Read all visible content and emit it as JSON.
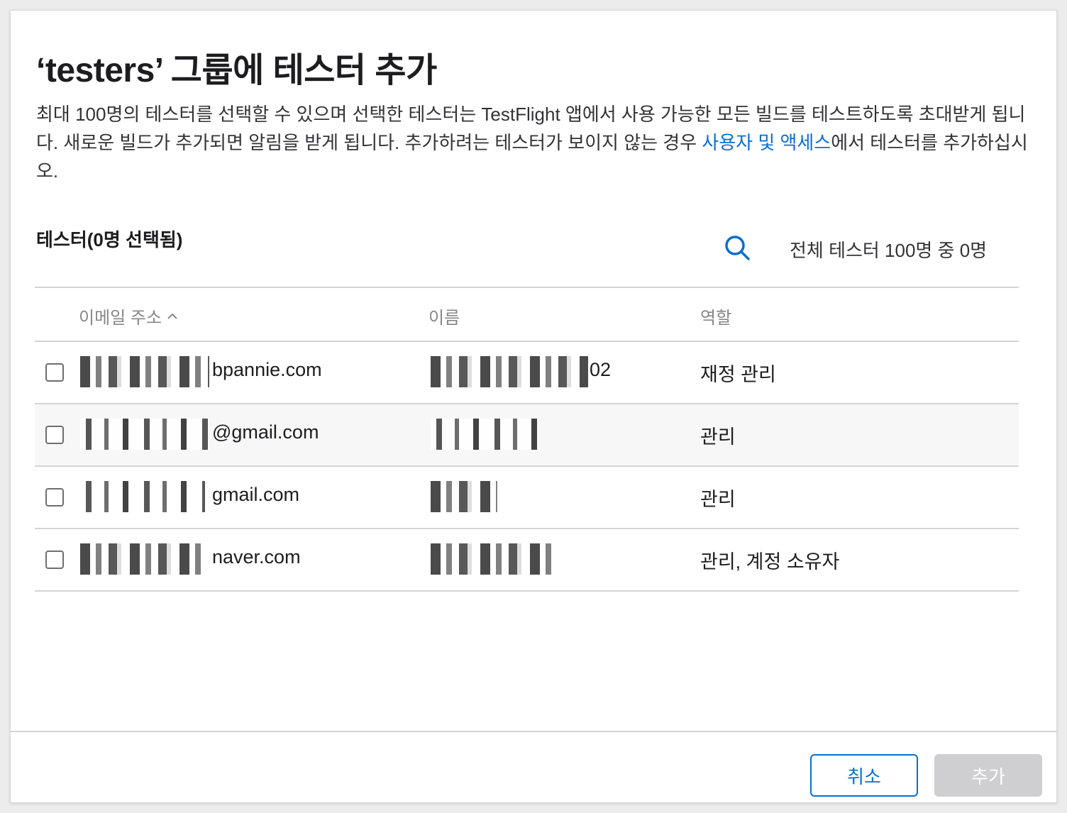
{
  "dialog": {
    "title": "‘testers’ 그룹에 테스터 추가",
    "description_part1": "최대 100명의 테스터를 선택할 수 있으며 선택한 테스터는 TestFlight 앱에서 사용 가능한 모든 빌드를 테스트하도록 초대받게 됩니다. 새로운 빌드가 추가되면 알림을 받게 됩니다. 추가하려는 테스터가 보이지 않는 경우 ",
    "description_link": "사용자 및 액세스",
    "description_part2": "에서 테스터를 추가하십시오."
  },
  "testers": {
    "section_title": "테스터(0명 선택됨)",
    "count_label": "전체 테스터 100명 중 0명",
    "columns": {
      "email": "이메일 주소",
      "name": "이름",
      "role": "역할"
    },
    "rows": [
      {
        "email_visible": "bpannie.com",
        "name_visible": "02",
        "role": "재정 관리"
      },
      {
        "email_visible": "@gmail.com",
        "name_visible": "",
        "role": "관리"
      },
      {
        "email_visible": "gmail.com",
        "name_visible": "",
        "role": "관리"
      },
      {
        "email_visible": "naver.com",
        "name_visible": "",
        "role": "관리, 계정 소유자"
      }
    ]
  },
  "footer": {
    "cancel_label": "취소",
    "add_label": "추가"
  },
  "colors": {
    "link": "#0a6fd0",
    "disabled_button": "#cfcfd1",
    "divider": "#d4d4d6"
  },
  "icons": {
    "search": "search-icon",
    "sort": "chevron-up-icon"
  }
}
